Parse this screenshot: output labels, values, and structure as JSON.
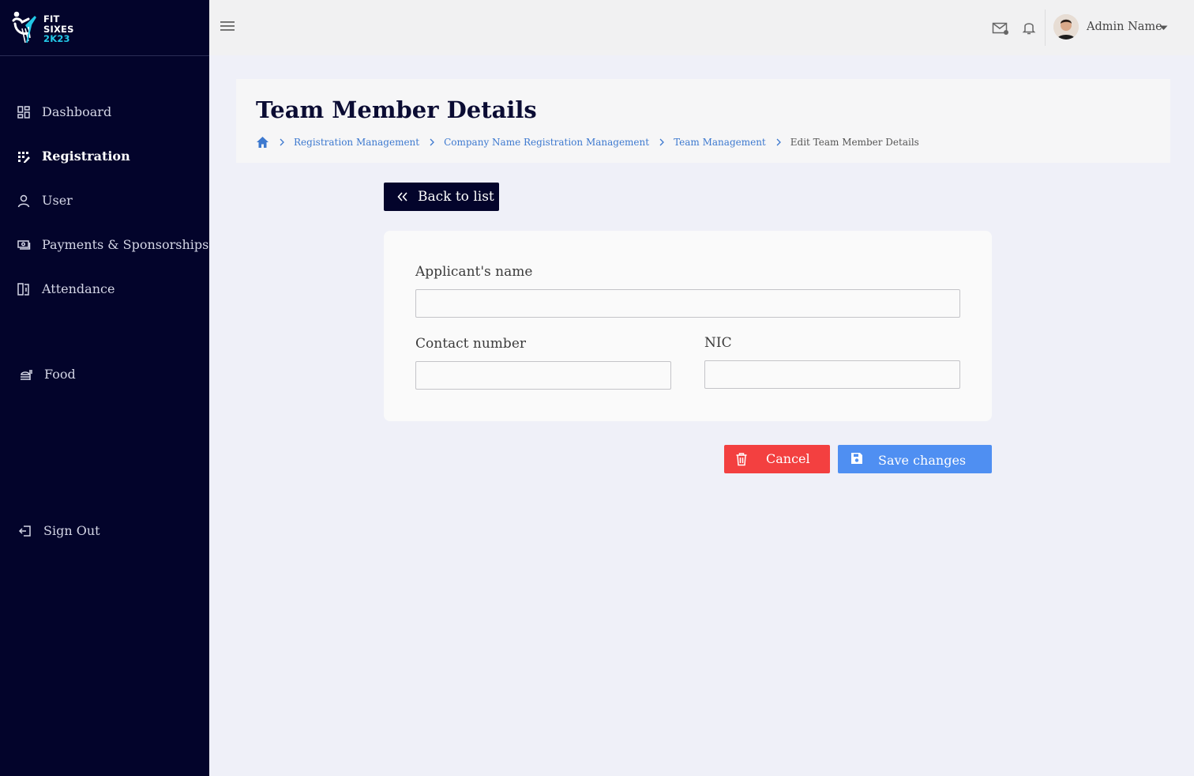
{
  "brand": {
    "line1": "FIT",
    "line2": "SIXES",
    "line3": "2K23",
    "accent_color": "#22c8e6",
    "sidebar_bg": "#03042b"
  },
  "sidebar": {
    "items": [
      {
        "label": "Dashboard",
        "icon": "dashboard-icon",
        "active": false
      },
      {
        "label": "Registration",
        "icon": "registration-icon",
        "active": true
      },
      {
        "label": "User",
        "icon": "user-icon",
        "active": false
      },
      {
        "label": "Payments & Sponsorships",
        "icon": "payments-icon",
        "active": false
      },
      {
        "label": "Attendance",
        "icon": "attendance-icon",
        "active": false
      },
      {
        "label": "Food",
        "icon": "food-icon",
        "active": false
      }
    ],
    "sign_out": "Sign Out"
  },
  "topbar": {
    "user_name": "Admin Name",
    "icons": [
      "menu-icon",
      "mail-icon",
      "bell-icon",
      "caret-down-icon"
    ]
  },
  "header": {
    "title": "Team Member Details",
    "breadcrumb": [
      "Registration Management",
      "Company Name Registration Management",
      "Team Management",
      "Edit Team Member Details"
    ]
  },
  "back_button": "Back to list",
  "form": {
    "applicant_name": {
      "label": "Applicant's name",
      "value": ""
    },
    "contact_number": {
      "label": "Contact number",
      "value": ""
    },
    "nic": {
      "label": "NIC",
      "value": ""
    }
  },
  "actions": {
    "cancel": "Cancel",
    "save": "Save changes",
    "cancel_color": "#f34040",
    "save_color": "#4f8ff2"
  }
}
